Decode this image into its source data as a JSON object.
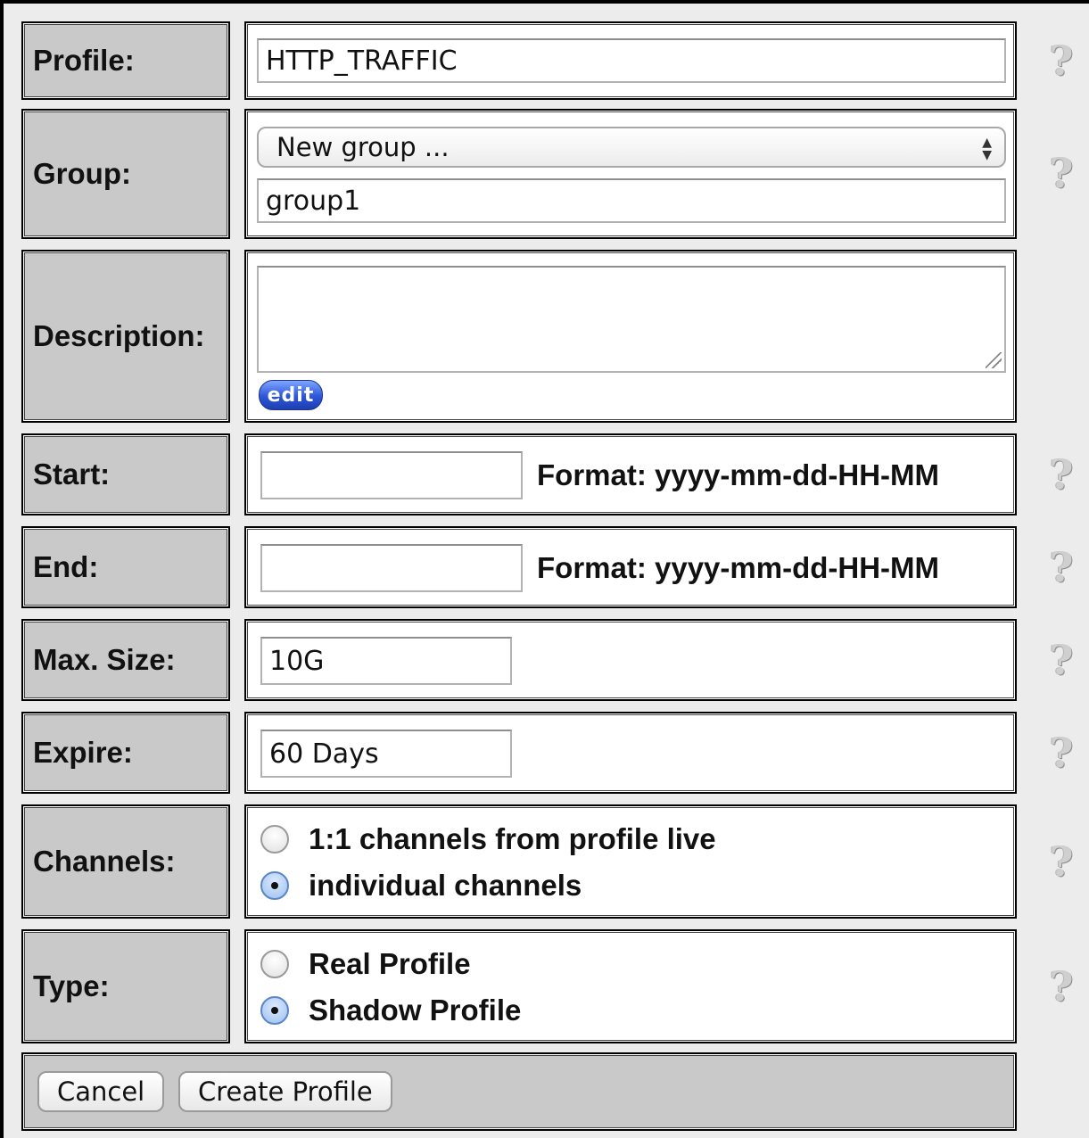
{
  "form": {
    "profile": {
      "label": "Profile:",
      "value": "HTTP_TRAFFIC"
    },
    "group": {
      "label": "Group:",
      "selected": "New group ...",
      "value": "group1"
    },
    "description": {
      "label": "Description:",
      "value": "",
      "edit_label": "edit"
    },
    "start": {
      "label": "Start:",
      "value": "",
      "hint": "Format: yyyy-mm-dd-HH-MM"
    },
    "end": {
      "label": "End:",
      "value": "",
      "hint": "Format: yyyy-mm-dd-HH-MM"
    },
    "max_size": {
      "label": "Max. Size:",
      "value": "10G"
    },
    "expire": {
      "label": "Expire:",
      "value": "60 Days"
    },
    "channels": {
      "label": "Channels:",
      "options": [
        {
          "label": "1:1 channels from profile live",
          "checked": false
        },
        {
          "label": "individual channels",
          "checked": true
        }
      ]
    },
    "type": {
      "label": "Type:",
      "options": [
        {
          "label": "Real Profile",
          "checked": false
        },
        {
          "label": "Shadow Profile",
          "checked": true
        }
      ]
    }
  },
  "help_icon": "question-mark-icon",
  "actions": {
    "cancel_label": "Cancel",
    "create_label": "Create Profile"
  }
}
